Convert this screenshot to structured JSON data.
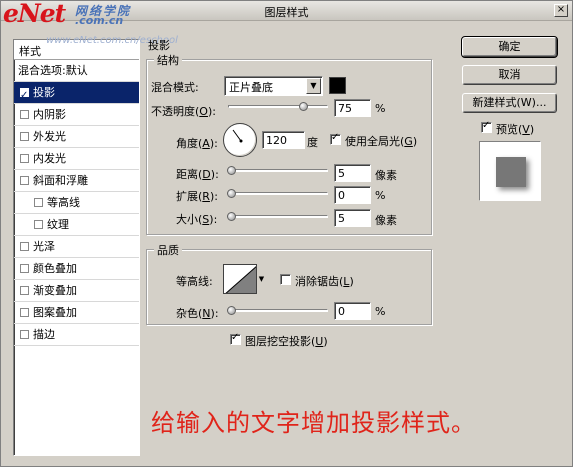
{
  "window": {
    "title": "图层样式",
    "close_glyph": "×",
    "watermark": {
      "logo": "eNet",
      "logo_sub": "网络学院",
      "logo_com": ".com.cn",
      "url": "www.eNet.com.cn/eschool"
    }
  },
  "style_list": {
    "header": "样式",
    "items": [
      {
        "label": "混合选项:默认",
        "checkbox": false,
        "checked": false,
        "selected": false,
        "indent": false
      },
      {
        "label": "投影",
        "checkbox": true,
        "checked": true,
        "selected": true,
        "indent": false
      },
      {
        "label": "内阴影",
        "checkbox": true,
        "checked": false,
        "selected": false,
        "indent": false
      },
      {
        "label": "外发光",
        "checkbox": true,
        "checked": false,
        "selected": false,
        "indent": false
      },
      {
        "label": "内发光",
        "checkbox": true,
        "checked": false,
        "selected": false,
        "indent": false
      },
      {
        "label": "斜面和浮雕",
        "checkbox": true,
        "checked": false,
        "selected": false,
        "indent": false
      },
      {
        "label": "等高线",
        "checkbox": true,
        "checked": false,
        "selected": false,
        "indent": true
      },
      {
        "label": "纹理",
        "checkbox": true,
        "checked": false,
        "selected": false,
        "indent": true
      },
      {
        "label": "光泽",
        "checkbox": true,
        "checked": false,
        "selected": false,
        "indent": false
      },
      {
        "label": "颜色叠加",
        "checkbox": true,
        "checked": false,
        "selected": false,
        "indent": false
      },
      {
        "label": "渐变叠加",
        "checkbox": true,
        "checked": false,
        "selected": false,
        "indent": false
      },
      {
        "label": "图案叠加",
        "checkbox": true,
        "checked": false,
        "selected": false,
        "indent": false
      },
      {
        "label": "描边",
        "checkbox": true,
        "checked": false,
        "selected": false,
        "indent": false
      }
    ]
  },
  "drop_shadow": {
    "section_title": "投影",
    "structure": {
      "group_title": "结构",
      "blend_mode_label": "混合模式:",
      "blend_mode_value": "正片叠底",
      "blend_color": "#000000",
      "opacity_label": "不透明度(",
      "opacity_key": "O",
      "opacity_suffix": "):",
      "opacity_value": "75",
      "opacity_level": 75,
      "opacity_unit": "%",
      "angle_label": "角度(",
      "angle_key": "A",
      "angle_suffix": "):",
      "angle_value": "120",
      "angle_unit": "度",
      "global_light_label": "使用全局光(",
      "global_light_key": "G",
      "global_light_suffix": ")",
      "global_light_checked": true,
      "distance_label": "距离(",
      "distance_key": "D",
      "distance_suffix": "):",
      "distance_value": "5",
      "distance_unit": "像素",
      "spread_label": "扩展(",
      "spread_key": "R",
      "spread_suffix": "):",
      "spread_value": "0",
      "spread_unit": "%",
      "size_label": "大小(",
      "size_key": "S",
      "size_suffix": "):",
      "size_value": "5",
      "size_unit": "像素"
    },
    "quality": {
      "group_title": "品质",
      "contour_label": "等高线:",
      "anti_alias_label": "消除锯齿(",
      "anti_alias_key": "L",
      "anti_alias_suffix": ")",
      "anti_alias_checked": false,
      "noise_label": "杂色(",
      "noise_key": "N",
      "noise_suffix": "):",
      "noise_value": "0",
      "noise_unit": "%"
    },
    "knockout_label": "图层挖空投影(",
    "knockout_key": "U",
    "knockout_suffix": ")",
    "knockout_checked": true
  },
  "buttons": {
    "ok": "确定",
    "cancel": "取消",
    "new_style": "新建样式(W)...",
    "preview_label": "预览(",
    "preview_key": "V",
    "preview_suffix": ")",
    "preview_checked": true
  },
  "caption": "给输入的文字增加投影样式。",
  "colors": {
    "dialog_bg": "#d4d0c8",
    "selection": "#0a246a",
    "caption": "#e0241a",
    "logo": "#d8141b"
  }
}
